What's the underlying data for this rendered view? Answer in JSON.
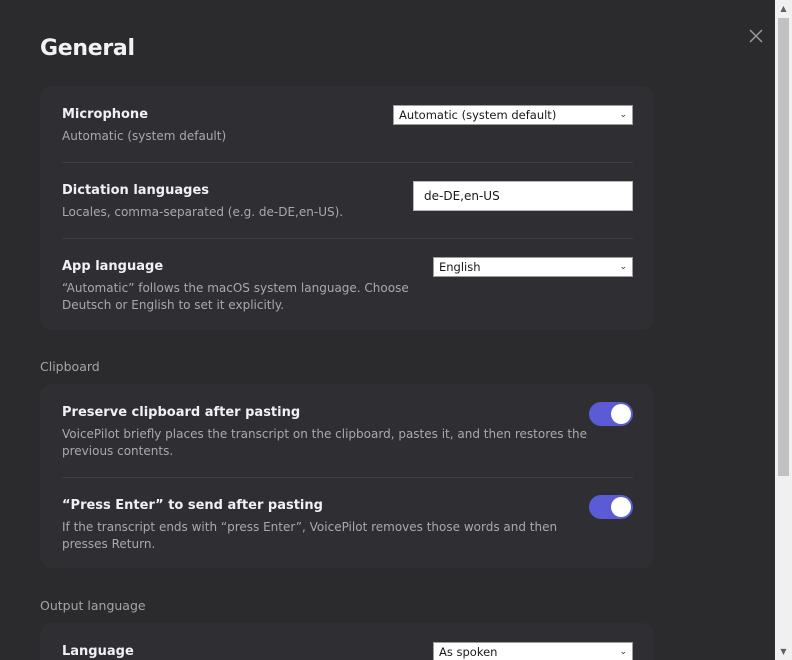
{
  "page": {
    "title": "General"
  },
  "general": {
    "microphone": {
      "title": "Microphone",
      "description": "Automatic (system default)",
      "selected": "Automatic (system default)"
    },
    "dictation": {
      "title": "Dictation languages",
      "description": "Locales, comma-separated (e.g. de-DE,en-US).",
      "value": "de-DE,en-US"
    },
    "app_language": {
      "title": "App language",
      "description_line1": "“Automatic” follows the macOS system language. Choose",
      "description_line2": "Deutsch or English to set it explicitly.",
      "selected": "English"
    }
  },
  "clipboard": {
    "section_label": "Clipboard",
    "preserve": {
      "title": "Preserve clipboard after pasting",
      "description_line1": "VoicePilot briefly places the transcript on the clipboard, pastes it, and then restores the",
      "description_line2": "previous contents.",
      "enabled": true
    },
    "press_enter": {
      "title": "“Press Enter” to send after pasting",
      "description_line1": "If the transcript ends with “press Enter”, VoicePilot removes those words and then",
      "description_line2": "presses Return.",
      "enabled": true
    }
  },
  "output": {
    "section_label": "Output language",
    "language": {
      "title": "Language",
      "selected": "As spoken"
    }
  },
  "icons": {
    "close": "close-icon",
    "chevron": "chevron-down-icon"
  },
  "colors": {
    "background": "#2b2b2e",
    "card": "#2f2f33",
    "accent_toggle": "#5b5bd6"
  }
}
